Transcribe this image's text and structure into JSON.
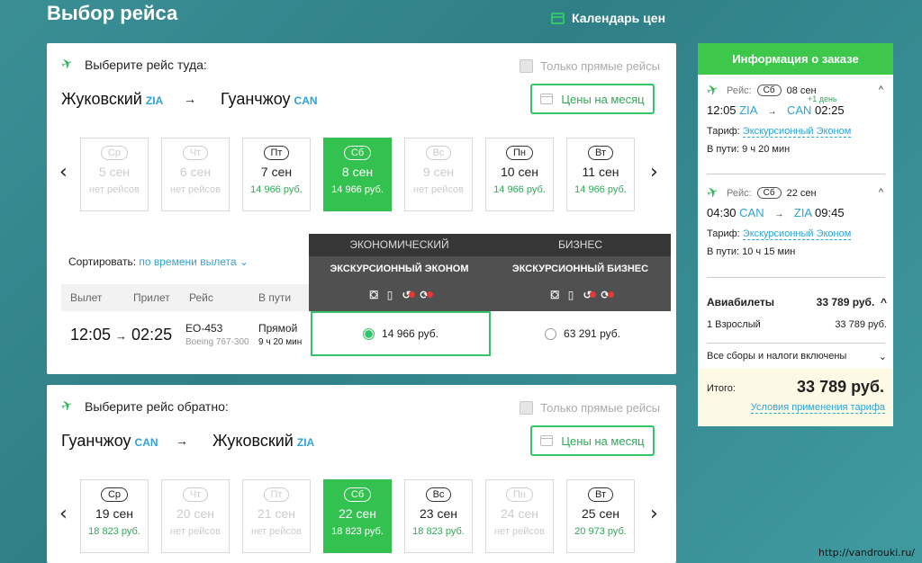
{
  "page": {
    "title": "Выбор рейса",
    "price_calendar": "Календарь цен",
    "watermark": "http://vandrouki.ru/"
  },
  "outbound": {
    "heading": "Выберите рейс туда:",
    "direct_only": "Только прямые рейсы",
    "from_city": "Жуковский",
    "from_code": "ZIA",
    "to_city": "Гуанчжоу",
    "to_code": "CAN",
    "arrow": "→",
    "month_prices": "Цены на месяц",
    "prev": "‹",
    "next": "›",
    "dates": [
      {
        "dow": "Ср",
        "day": "5 сен",
        "price": "нет рейсов"
      },
      {
        "dow": "Чт",
        "day": "6 сен",
        "price": "нет рейсов"
      },
      {
        "dow": "Пт",
        "day": "7 сен",
        "price": "14 966 руб."
      },
      {
        "dow": "Сб",
        "day": "8 сен",
        "price": "14 966 руб."
      },
      {
        "dow": "Вс",
        "day": "9 сен",
        "price": "нет рейсов"
      },
      {
        "dow": "Пн",
        "day": "10 сен",
        "price": "14 966 руб."
      },
      {
        "dow": "Вт",
        "day": "11 сен",
        "price": "14 966 руб."
      }
    ],
    "sort_label": "Сортировать:",
    "sort_value": "по времени вылета",
    "sort_chevron": "⌄",
    "columns": {
      "dep": "Вылет",
      "arr": "Прилет",
      "flight": "Рейс",
      "duration": "В пути"
    },
    "economy_class": "ЭКОНОМИЧЕСКИЙ",
    "economy_fare": "ЭКСКУРСИОННЫЙ ЭКОНОМ",
    "business_class": "БИЗНЕС",
    "business_fare": "ЭКСКУРСИОННЫЙ БИЗНЕС",
    "flight": {
      "dep_time": "12:05",
      "arrow": "→",
      "arr_time": "02:25",
      "number": "EO-453",
      "aircraft": "Boeing 767-300",
      "type": "Прямой",
      "duration": "9 ч 20 мин",
      "econ_price": "14 966 руб.",
      "biz_price": "63 291 руб."
    }
  },
  "return": {
    "heading": "Выберите рейс обратно:",
    "direct_only": "Только прямые рейсы",
    "from_city": "Гуанчжоу",
    "from_code": "CAN",
    "to_city": "Жуковский",
    "to_code": "ZIA",
    "arrow": "→",
    "month_prices": "Цены на месяц",
    "prev": "‹",
    "next": "›",
    "dates": [
      {
        "dow": "Ср",
        "day": "19 сен",
        "price": "18 823 руб."
      },
      {
        "dow": "Чт",
        "day": "20 сен",
        "price": "нет рейсов"
      },
      {
        "dow": "Пт",
        "day": "21 сен",
        "price": "нет рейсов"
      },
      {
        "dow": "Сб",
        "day": "22 сен",
        "price": "18 823 руб."
      },
      {
        "dow": "Вс",
        "day": "23 сен",
        "price": "18 823 руб."
      },
      {
        "dow": "Пн",
        "day": "24 сен",
        "price": "нет рейсов"
      },
      {
        "dow": "Вт",
        "day": "25 сен",
        "price": "20 973 руб."
      }
    ]
  },
  "order": {
    "title": "Информация о заказе",
    "seg1": {
      "label": "Рейс:",
      "day": "Сб",
      "date": "08 сен",
      "plus_day": "+1 день",
      "dep_time": "12:05",
      "dep_code": "ZIA",
      "arrow": "→",
      "arr_code": "CAN",
      "arr_time": "02:25",
      "tariff_label": "Тариф:",
      "tariff": "Экскурсионный Эконом",
      "enroute": "В пути: 9 ч 20 мин",
      "chevron": "^"
    },
    "seg2": {
      "label": "Рейс:",
      "day": "Сб",
      "date": "22 сен",
      "dep_time": "04:30",
      "dep_code": "CAN",
      "arrow": "→",
      "arr_code": "ZIA",
      "arr_time": "09:45",
      "tariff_label": "Тариф:",
      "tariff": "Экскурсионный Эконом",
      "enroute": "В пути: 10 ч 15 мин",
      "chevron": "^"
    },
    "tickets_label": "Авиабилеты",
    "tickets_total": "33 789 руб.",
    "tickets_chevron": "^",
    "adult_label": "1 Взрослый",
    "adult_price": "33 789 руб.",
    "fees": "Все сборы и налоги включены",
    "fees_chevron": "⌄",
    "total_label": "Итого:",
    "total": "33 789 руб.",
    "conditions": "Условия применения тарифа"
  },
  "colors": {
    "accent": "#33c56a",
    "selected_date": "#33c24f",
    "link": "#2ea3d6",
    "order_header": "#3ec84b"
  }
}
